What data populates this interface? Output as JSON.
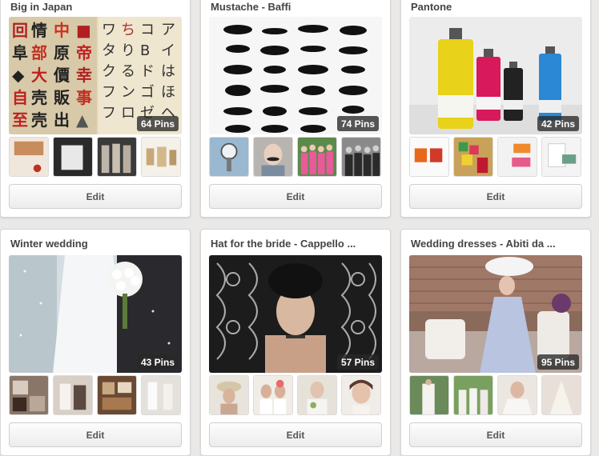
{
  "boards": [
    {
      "title": "Big in Japan",
      "pins": "64 Pins",
      "edit": "Edit"
    },
    {
      "title": "Mustache - Baffi",
      "pins": "74 Pins",
      "edit": "Edit"
    },
    {
      "title": "Pantone",
      "pins": "42 Pins",
      "edit": "Edit"
    },
    {
      "title": "Winter wedding",
      "pins": "43 Pins",
      "edit": "Edit"
    },
    {
      "title": "Hat for the bride - Cappello ...",
      "pins": "57 Pins",
      "edit": "Edit"
    },
    {
      "title": "Wedding dresses - Abiti da ...",
      "pins": "95 Pins",
      "edit": "Edit"
    }
  ],
  "colors": {
    "background": "#ebe8e8",
    "card": "#ffffff",
    "pin_badge": "#2b2b2b"
  }
}
